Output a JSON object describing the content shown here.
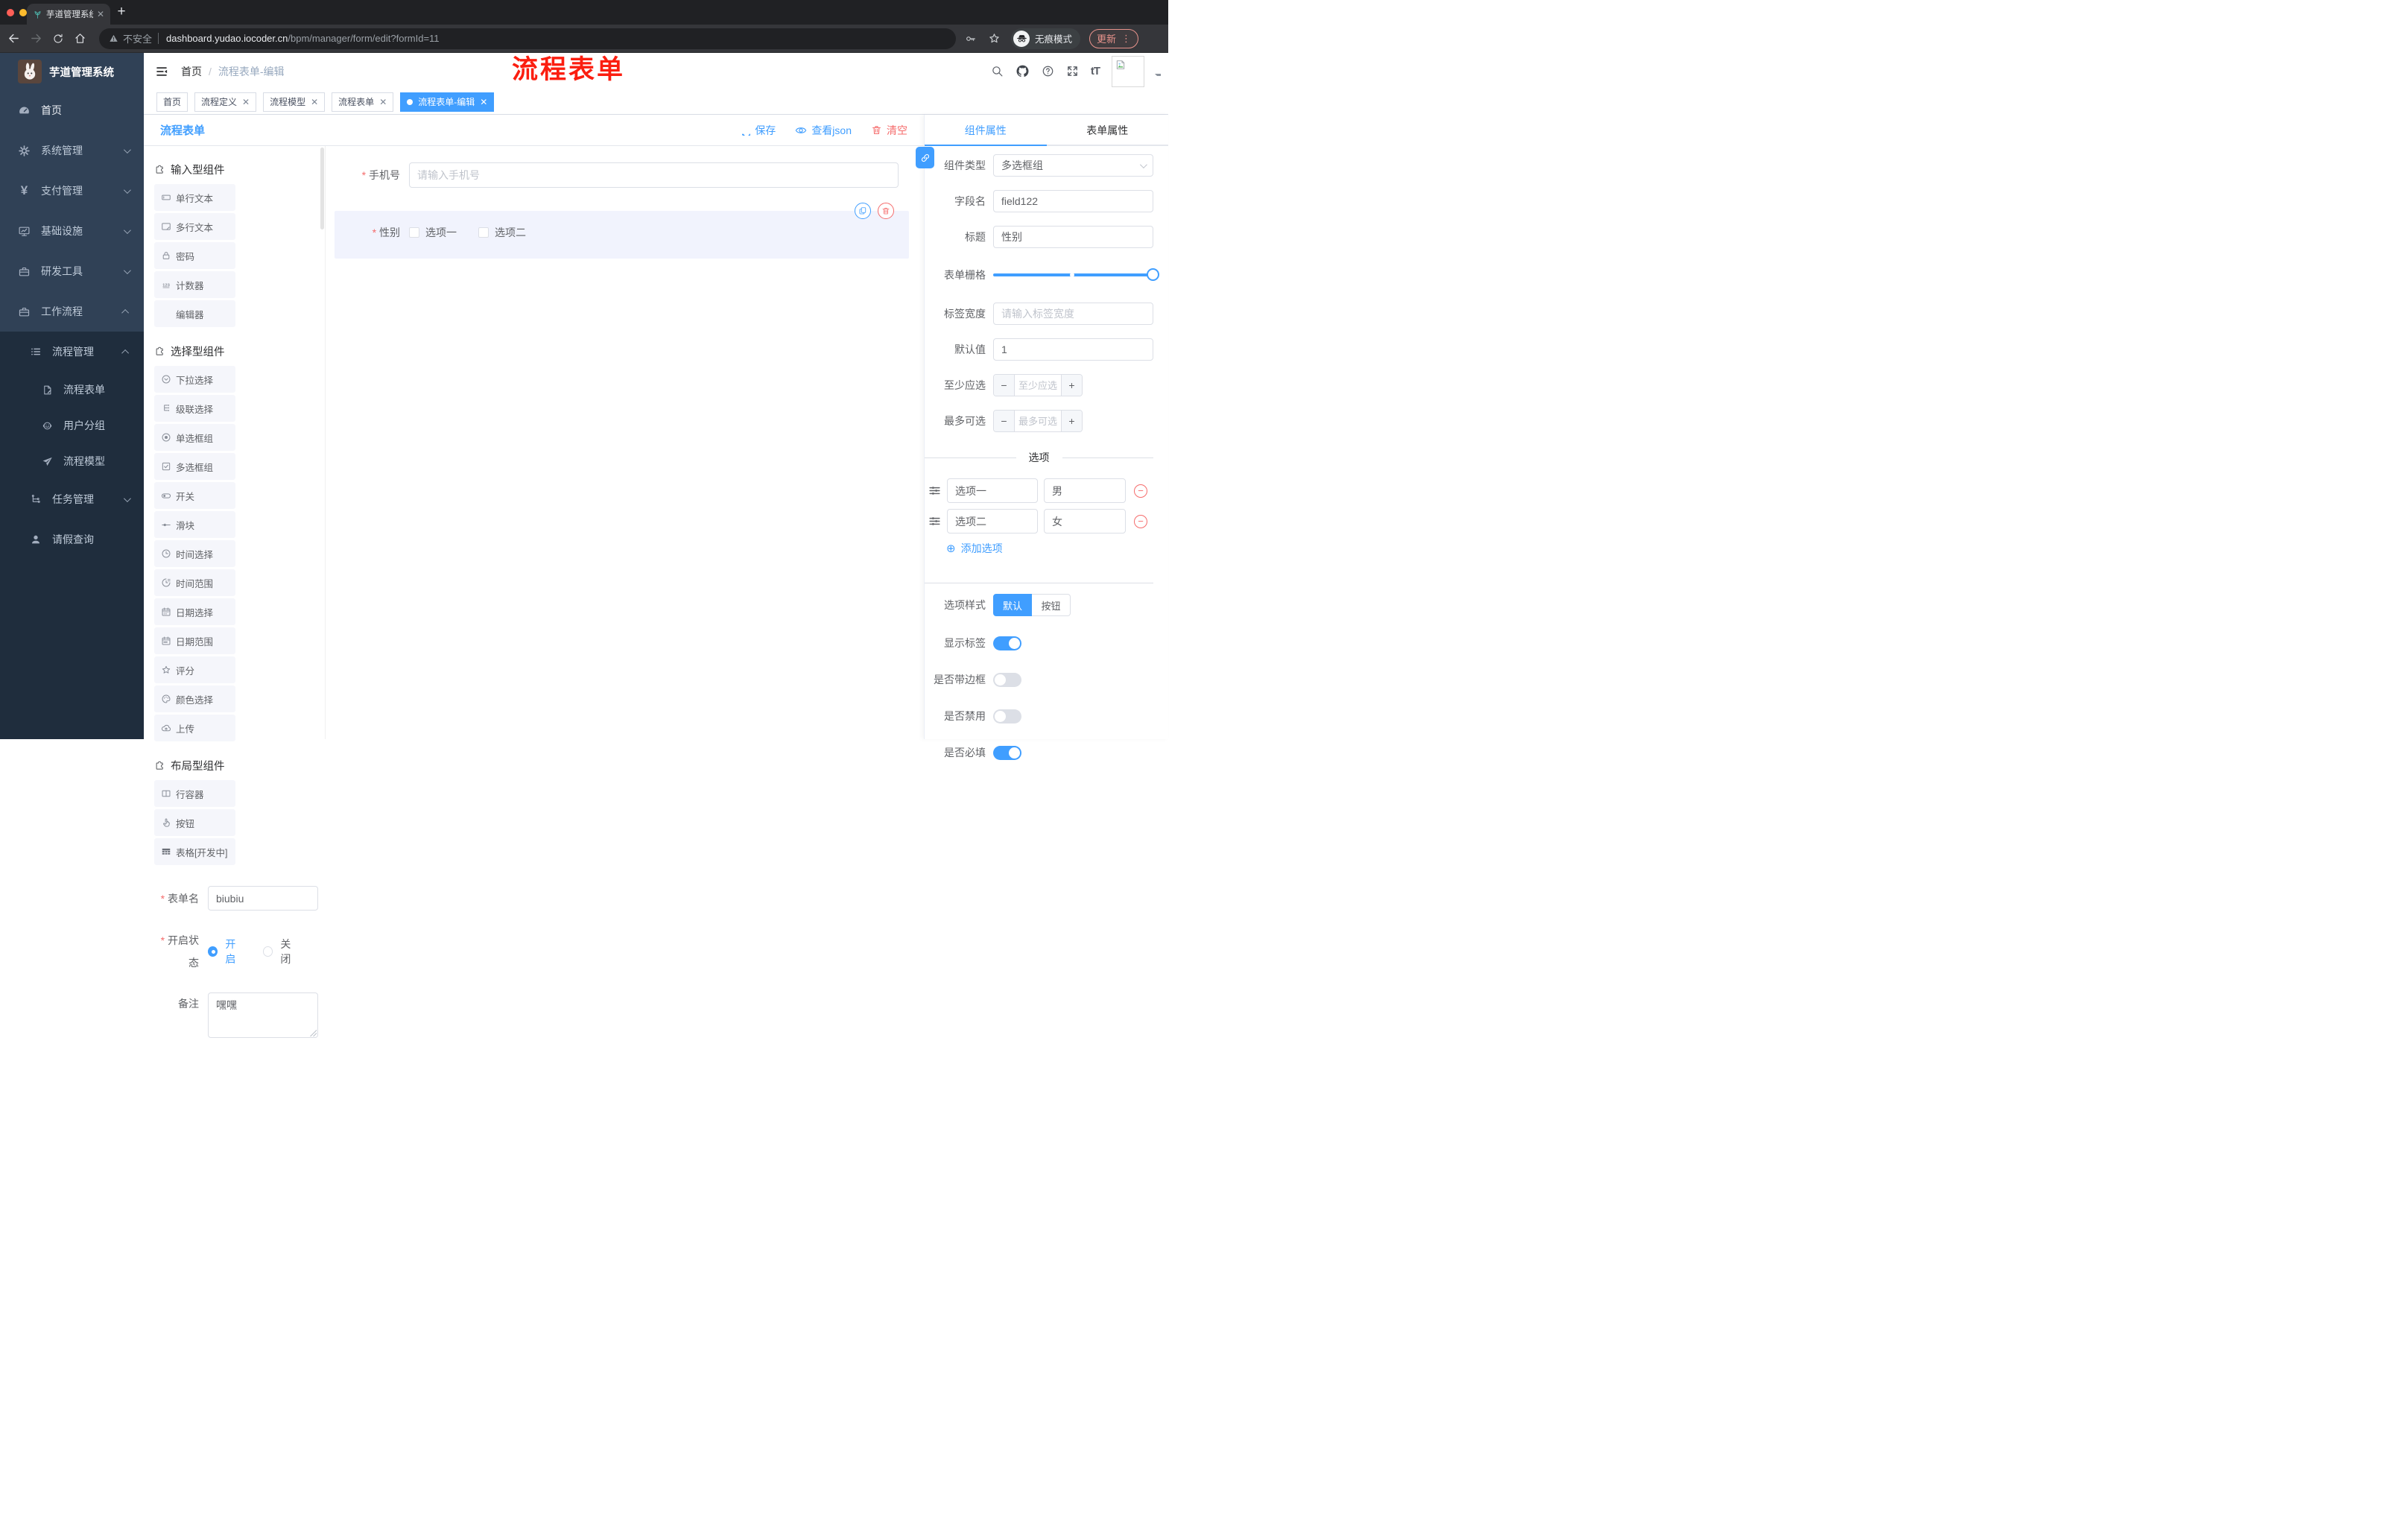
{
  "browser": {
    "tab_title": "芋道管理系统",
    "security_label": "不安全",
    "url_domain": "dashboard.yudao.iocoder.cn",
    "url_path": "/bpm/manager/form/edit?formId=11",
    "incognito_label": "无痕模式",
    "update_label": "更新"
  },
  "sidebar": {
    "logo_title": "芋道管理系统",
    "menu": [
      {
        "label": "首页"
      },
      {
        "label": "系统管理"
      },
      {
        "label": "支付管理"
      },
      {
        "label": "基础设施"
      },
      {
        "label": "研发工具"
      },
      {
        "label": "工作流程"
      },
      {
        "label": "流程管理"
      },
      {
        "label": "流程表单"
      },
      {
        "label": "用户分组"
      },
      {
        "label": "流程模型"
      },
      {
        "label": "任务管理"
      },
      {
        "label": "请假查询"
      }
    ]
  },
  "navbar": {
    "breadcrumb_home": "首页",
    "breadcrumb_sep": "/",
    "breadcrumb_current": "流程表单-编辑",
    "annotation": "流程表单"
  },
  "tags": [
    {
      "label": "首页"
    },
    {
      "label": "流程定义"
    },
    {
      "label": "流程模型"
    },
    {
      "label": "流程表单"
    },
    {
      "label": "流程表单-编辑"
    }
  ],
  "designer": {
    "title": "流程表单",
    "save": "保存",
    "view_json": "查看json",
    "clear": "清空"
  },
  "components": {
    "groups": [
      {
        "title": "输入型组件",
        "items": [
          {
            "label": "单行文本"
          },
          {
            "label": "多行文本"
          },
          {
            "label": "密码"
          },
          {
            "label": "计数器"
          },
          {
            "label": "编辑器"
          }
        ]
      },
      {
        "title": "选择型组件",
        "items": [
          {
            "label": "下拉选择"
          },
          {
            "label": "级联选择"
          },
          {
            "label": "单选框组"
          },
          {
            "label": "多选框组"
          },
          {
            "label": "开关"
          },
          {
            "label": "滑块"
          },
          {
            "label": "时间选择"
          },
          {
            "label": "时间范围"
          },
          {
            "label": "日期选择"
          },
          {
            "label": "日期范围"
          },
          {
            "label": "评分"
          },
          {
            "label": "颜色选择"
          },
          {
            "label": "上传"
          }
        ]
      },
      {
        "title": "布局型组件",
        "items": [
          {
            "label": "行容器"
          },
          {
            "label": "按钮"
          },
          {
            "label": "表格[开发中]"
          }
        ]
      }
    ],
    "form_meta": {
      "name_label": "表单名",
      "name_value": "biubiu",
      "status_label": "开启状态",
      "status_on": "开启",
      "status_off": "关闭",
      "remark_label": "备注",
      "remark_value": "嘿嘿"
    }
  },
  "canvas": {
    "phone_label": "手机号",
    "phone_placeholder": "请输入手机号",
    "gender_label": "性别",
    "gender_options": [
      {
        "label": "选项一"
      },
      {
        "label": "选项二"
      }
    ]
  },
  "props": {
    "tab_component": "组件属性",
    "tab_form": "表单属性",
    "component_type_label": "组件类型",
    "component_type_value": "多选框组",
    "field_name_label": "字段名",
    "field_name_value": "field122",
    "title_label": "标题",
    "title_value": "性别",
    "grid_label": "表单栅格",
    "label_width_label": "标签宽度",
    "label_width_placeholder": "请输入标签宽度",
    "default_label": "默认值",
    "default_value": "1",
    "min_label": "至少应选",
    "min_placeholder": "至少应选",
    "max_label": "最多可选",
    "max_placeholder": "最多可选",
    "options_divider": "选项",
    "options": [
      {
        "label": "选项一",
        "value": "男"
      },
      {
        "label": "选项二",
        "value": "女"
      }
    ],
    "add_option": "添加选项",
    "style_label": "选项样式",
    "style_default": "默认",
    "style_button": "按钮",
    "toggles": [
      {
        "label": "显示标签",
        "on": true
      },
      {
        "label": "是否带边框",
        "on": false
      },
      {
        "label": "是否禁用",
        "on": false
      },
      {
        "label": "是否必填",
        "on": true
      }
    ],
    "accent_color": "#409eff",
    "danger_color": "#f56c6c"
  }
}
